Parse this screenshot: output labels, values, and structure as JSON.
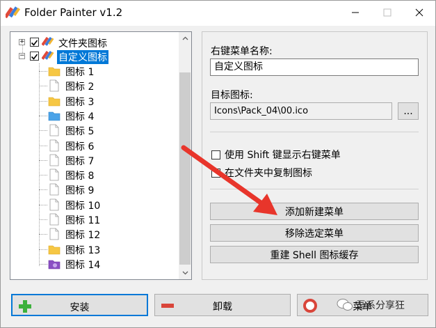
{
  "window": {
    "title": "Folder Painter v1.2",
    "minimize_icon": "minimize-icon",
    "maximize_icon": "maximize-icon",
    "close_icon": "close-icon"
  },
  "tree": {
    "groups": [
      {
        "label": "文件夹图标",
        "checked": true,
        "expanded": false
      },
      {
        "label": "自定义图标",
        "checked": true,
        "expanded": true,
        "selected": true
      }
    ],
    "items": [
      {
        "label": "图标 1",
        "icon": "folder-yellow-icon"
      },
      {
        "label": "图标 2",
        "icon": "blank-file-icon"
      },
      {
        "label": "图标 3",
        "icon": "folder-yellow-icon"
      },
      {
        "label": "图标 4",
        "icon": "folder-blue-icon"
      },
      {
        "label": "图标 5",
        "icon": "blank-file-icon"
      },
      {
        "label": "图标 6",
        "icon": "blank-file-icon"
      },
      {
        "label": "图标 7",
        "icon": "blank-file-icon"
      },
      {
        "label": "图标 8",
        "icon": "blank-file-icon"
      },
      {
        "label": "图标 9",
        "icon": "blank-file-icon"
      },
      {
        "label": "图标 10",
        "icon": "blank-file-icon"
      },
      {
        "label": "图标 11",
        "icon": "blank-file-icon"
      },
      {
        "label": "图标 12",
        "icon": "blank-file-icon"
      },
      {
        "label": "图标 13",
        "icon": "folder-yellow-icon"
      },
      {
        "label": "图标 14",
        "icon": "folder-purple-icon"
      }
    ]
  },
  "panel": {
    "menu_name_label": "右键菜单名称:",
    "menu_name_value": "自定义图标",
    "target_icon_label": "目标图标:",
    "target_icon_value": "Icons\\Pack_04\\00.ico",
    "browse_label": "...",
    "shift_checkbox_label": "使用 Shift 键显示右键菜单",
    "copy_checkbox_label": "在文件夹中复制图标",
    "add_menu_label": "添加新建菜单",
    "remove_menu_label": "移除选定菜单",
    "rebuild_cache_label": "重建 Shell 图标缓存"
  },
  "bottom": {
    "install_label": "安装",
    "uninstall_label": "卸载",
    "menu_label": "菜单"
  },
  "watermark": {
    "text": "吾系分享狂"
  },
  "colors": {
    "selection": "#0078d7",
    "arrow": "#e8352b",
    "install_plus": "#3cb13c",
    "uninstall_minus": "#d9453a"
  }
}
